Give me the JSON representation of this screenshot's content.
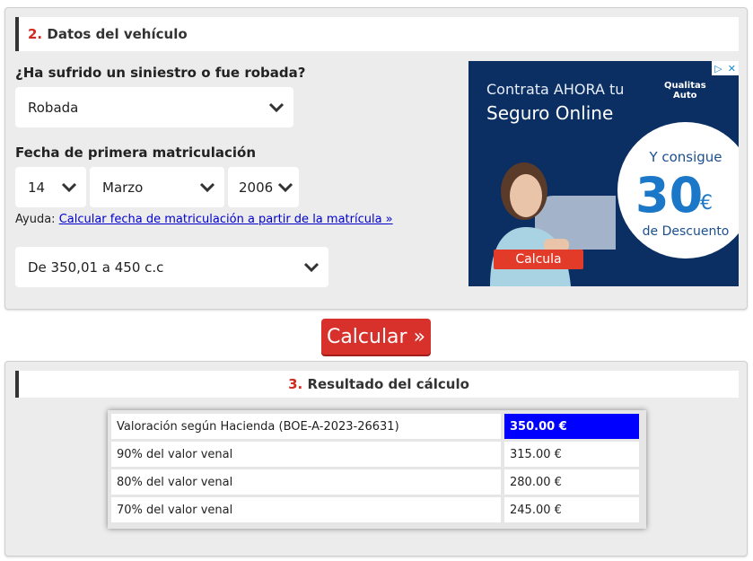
{
  "section2": {
    "number": "2.",
    "title": "Datos del vehículo"
  },
  "siniestro": {
    "question": "¿Ha sufrido un siniestro o fue robada?",
    "selected": "Robada"
  },
  "matriculacion": {
    "label": "Fecha de primera matriculación",
    "day": "14",
    "month": "Marzo",
    "year": "2006"
  },
  "help": {
    "prefix": "Ayuda:",
    "link": "Calcular fecha de matriculación a partir de la matrícula »"
  },
  "cilindrada": {
    "selected": "De 350,01 a 450 c.c"
  },
  "ad": {
    "line1": "Contrata AHORA tu",
    "line2": "Seguro Online",
    "brand_line1": "Qualitas",
    "brand_line2": "Auto",
    "promo_top": "Y consigue",
    "promo_number": "30",
    "promo_currency": "€",
    "promo_bottom": "de Descuento",
    "cta": "Calcula",
    "colors": {
      "background": "#0b2f63",
      "cta": "#e23b2a",
      "accent": "#1b77c7"
    }
  },
  "calculate_button": "Calcular »",
  "section3": {
    "number": "3.",
    "title": "Resultado del cálculo"
  },
  "results": [
    {
      "label": "Valoración según Hacienda (BOE-A-2023-26631)",
      "value": "350.00 €",
      "highlight": true
    },
    {
      "label": "90% del valor venal",
      "value": "315.00 €",
      "highlight": false
    },
    {
      "label": "80% del valor venal",
      "value": "280.00 €",
      "highlight": false
    },
    {
      "label": "70% del valor venal",
      "value": "245.00 €",
      "highlight": false
    }
  ],
  "colors": {
    "accent_red": "#d8302b",
    "highlight_blue": "#0000ff",
    "link_blue": "#0000cc"
  }
}
